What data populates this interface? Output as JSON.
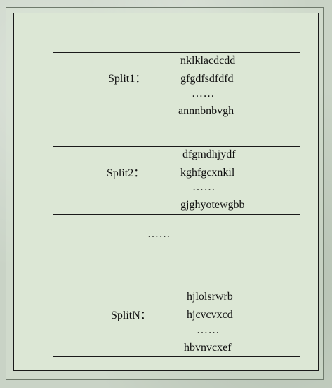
{
  "diagram": {
    "splits": [
      {
        "label": "Split1：",
        "lines": [
          "nklklacdcdd",
          "gfgdfsdfdfd",
          "……",
          "annnbnbvgh"
        ]
      },
      {
        "label": "Split2：",
        "lines": [
          "dfgmdhjydf",
          "kghfgcxnkil",
          "……",
          "gjghyotewgbb"
        ]
      },
      {
        "label": "SplitN：",
        "lines": [
          "hjlolsrwrb",
          "hjcvcvxcd",
          "……",
          "hbvnvcxef"
        ]
      }
    ],
    "between_ellipsis": "……"
  },
  "colors": {
    "background": "#c9d3c6",
    "panel": "#dce7d5",
    "stroke": "#1a1a1a"
  }
}
